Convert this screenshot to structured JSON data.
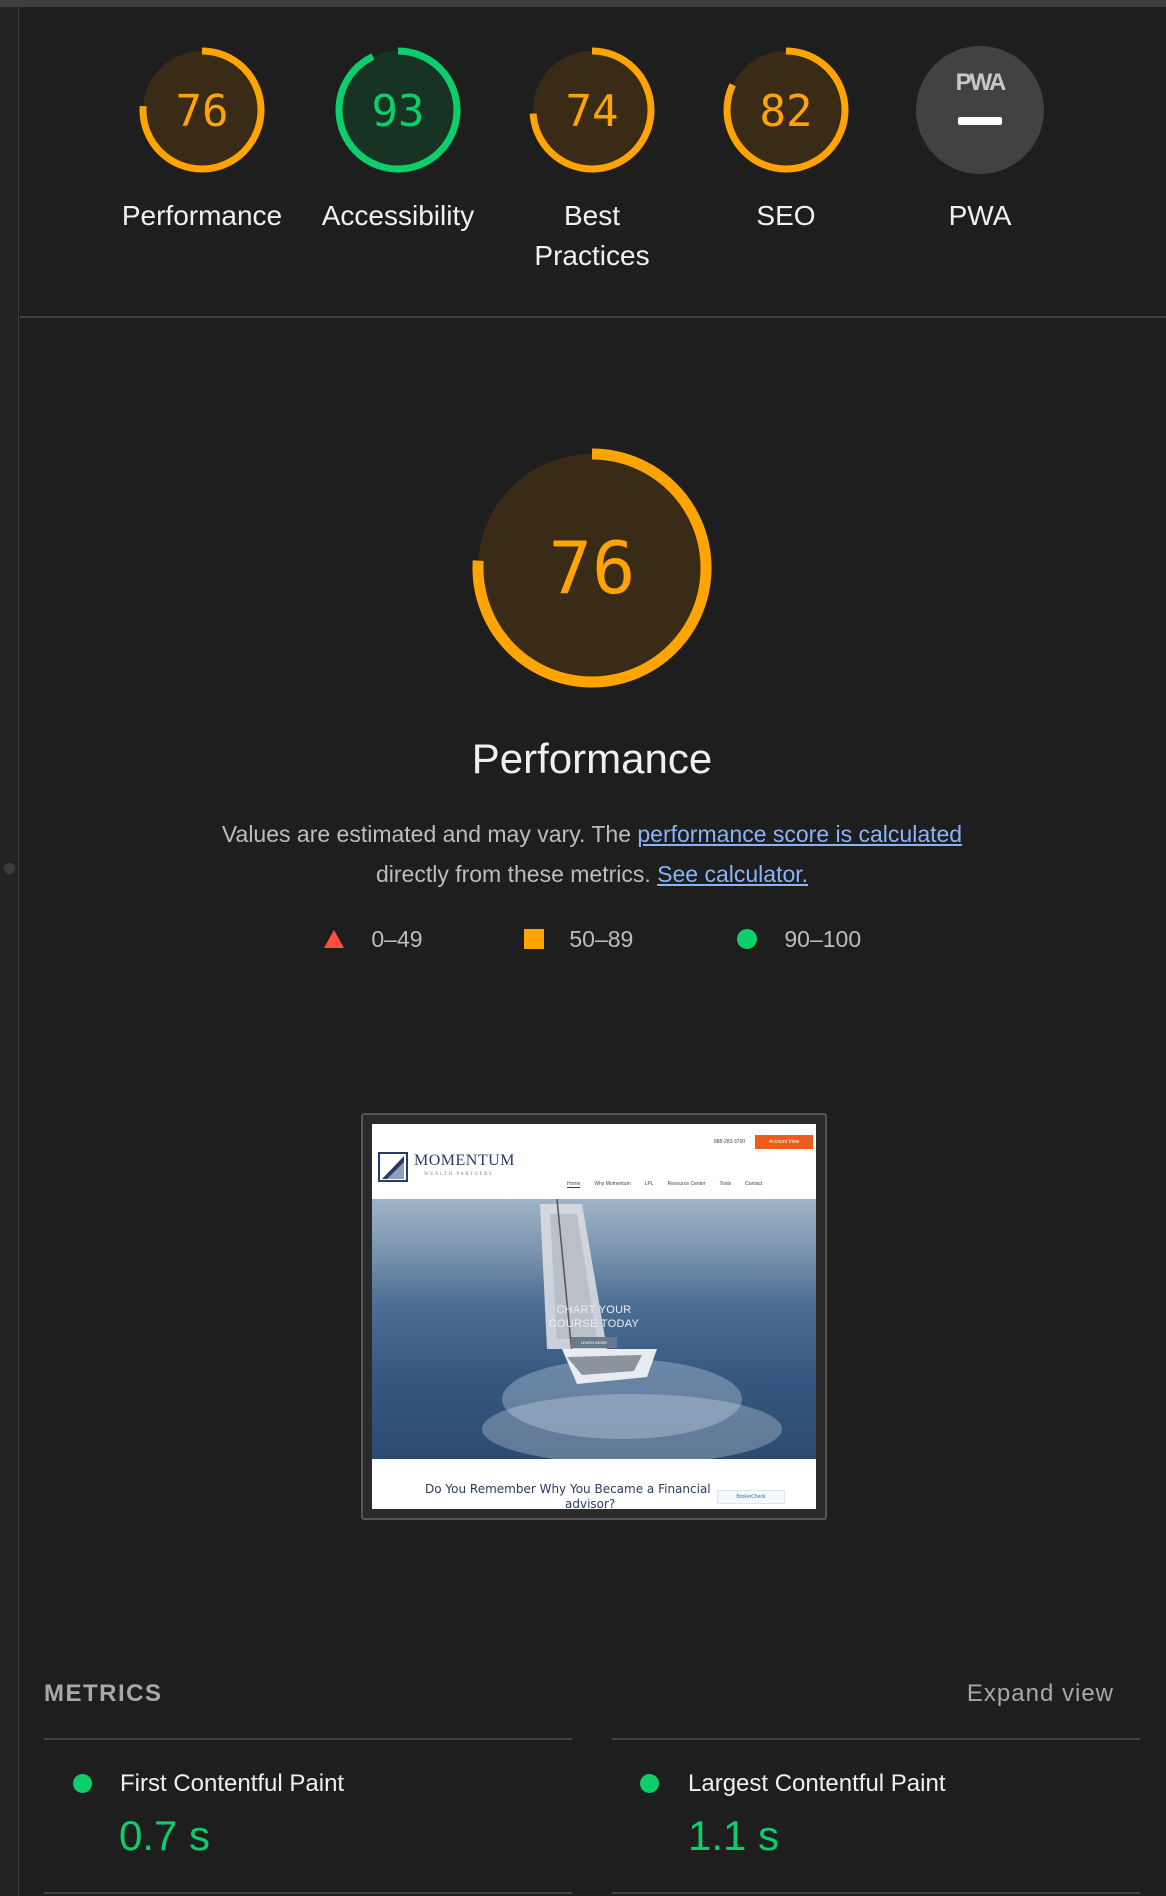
{
  "colors": {
    "average": "#ffa400",
    "pass": "#0cce6b",
    "fail": "#ff4e42",
    "link": "#8ab4f8"
  },
  "gauges": [
    {
      "score": "76",
      "value": 76,
      "label": "Performance",
      "color": "#ffa400"
    },
    {
      "score": "93",
      "value": 93,
      "label": "Accessibility",
      "color": "#0cce6b"
    },
    {
      "score": "74",
      "value": 74,
      "label": "Best Practices",
      "color": "#ffa400"
    },
    {
      "score": "82",
      "value": 82,
      "label": "SEO",
      "color": "#ffa400"
    },
    {
      "score": "",
      "value": 0,
      "label": "PWA",
      "logo": "PWA",
      "icon": "pwa-badge-icon"
    }
  ],
  "main": {
    "score": "76",
    "value": 76,
    "title": "Performance",
    "desc_prefix": "Values are estimated and may vary. The ",
    "link_calc": "performance score is calculated",
    "desc_mid": " directly from these metrics. ",
    "link_see": "See calculator."
  },
  "legend": [
    {
      "range": "0–49",
      "icon": "triangle-fail-icon"
    },
    {
      "range": "50–89",
      "icon": "square-average-icon"
    },
    {
      "range": "90–100",
      "icon": "circle-pass-icon"
    }
  ],
  "thumbnail": {
    "brand": "MOMENTUM",
    "brand_sub": "WEALTH PARTNERS",
    "phone": "888-283-3700",
    "cta": "Account View",
    "nav": [
      "Home",
      "Why Momentum",
      "LPL",
      "Resource Center",
      "Tools",
      "Contact"
    ],
    "hero_line1": "CHART YOUR",
    "hero_line2": "COURSE TODAY",
    "hero_button": "LEARN MORE",
    "footer_text": "Do You Remember Why You Became a Financial",
    "footer_text2": "advisor?",
    "footer_badge": "BrokerCheck"
  },
  "metrics": {
    "title": "METRICS",
    "expand": "Expand view",
    "items": [
      {
        "label": "First Contentful Paint",
        "value": "0.7 s",
        "status": "pass"
      },
      {
        "label": "Largest Contentful Paint",
        "value": "1.1 s",
        "status": "pass"
      }
    ]
  }
}
